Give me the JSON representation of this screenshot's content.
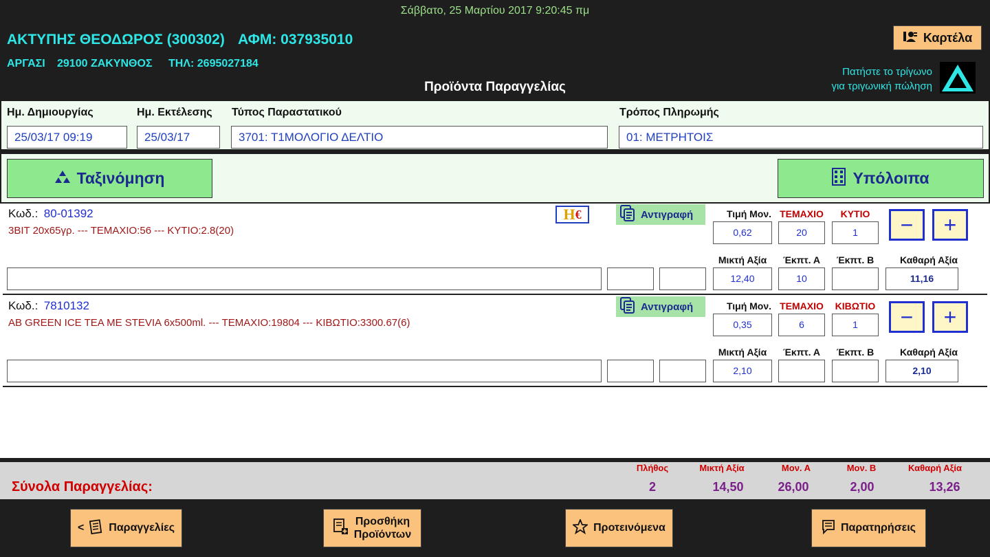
{
  "header": {
    "datetime": "Σάββατο, 25 Μαρτίου 2017   9:20:45 πμ",
    "customer_name": "ΑΚΤΥΠΗΣ ΘΕΟΔΩΡΟΣ (300302)",
    "customer_afm": "ΑΦΜ: 037935010",
    "customer_city": "ΑΡΓΑΣΙ",
    "customer_zip": "29100 ΖΑΚΥΝΘΟΣ",
    "customer_tel": "ΤΗΛ: 2695027184",
    "kartela_label": "Καρτέλα",
    "triangle_hint_1": "Πατήστε το τρίγωνο",
    "triangle_hint_2": "για τριγωνική πώληση",
    "page_title": "Προϊόντα Παραγγελίας"
  },
  "docinfo": {
    "created_label": "Ημ. Δημιουργίας",
    "created_value": "25/03/17 09:19",
    "exec_label": "Ημ. Εκτέλεσης",
    "exec_value": "25/03/17",
    "doctype_label": "Τύπος Παραστατικού",
    "doctype_value": "3701: Τ1ΜΟΛΟΓΙΟ ΔΕΛΤΙΟ",
    "payment_label": "Τρόπος Πληρωμής",
    "payment_value": "01: ΜΕΤΡΗΤΟΙΣ"
  },
  "toolbar": {
    "sort_label": "Ταξινόμηση",
    "balances_label": "Υπόλοιπα"
  },
  "row_labels": {
    "code": "Κωδ.:",
    "copy": "Αντιγραφή",
    "unit_price": "Τιμή Μον.",
    "gross": "Μικτή Αξία",
    "disc_a": "Έκπτ. Α",
    "disc_b": "Έκπτ. Β",
    "net": "Καθαρή Αξία",
    "minus": "−",
    "plus": "+"
  },
  "products": [
    {
      "code": "80-01392",
      "description": "3BIT 20x65γρ. --- ΤΕΜΑΧΙΟ:56 --- ΚΥΤΙΟ:2.8(20)",
      "unit1": "ΤΕΜΑΧΙΟ",
      "unit2": "ΚΥΤΙΟ",
      "unit_price": "0,62",
      "qty1": "20",
      "qty2": "1",
      "gross": "12,40",
      "disc_a": "10",
      "disc_b": "",
      "net": "11,16",
      "comment": "",
      "extra1": "",
      "extra2": "",
      "badge": "H€"
    },
    {
      "code": "7810132",
      "description": "AB GREEN ICE TEA ME STEVIA 6x500ml. --- ΤΕΜΑΧΙΟ:19804 --- ΚΙΒΩΤΙΟ:3300.67(6)",
      "unit1": "ΤΕΜΑΧΙΟ",
      "unit2": "ΚΙΒΩΤΙΟ",
      "unit_price": "0,35",
      "qty1": "6",
      "qty2": "1",
      "gross": "2,10",
      "disc_a": "",
      "disc_b": "",
      "net": "2,10",
      "comment": "",
      "extra1": "",
      "extra2": ""
    }
  ],
  "totals": {
    "label": "Σύνολα Παραγγελίας:",
    "count_label": "Πλήθος",
    "count": "2",
    "gross_label": "Μικτή Αξία",
    "gross": "14,50",
    "units_a_label": "Μον. Α",
    "units_a": "26,00",
    "units_b_label": "Μον. Β",
    "units_b": "2,00",
    "net_label": "Καθαρή Αξία",
    "net": "13,26"
  },
  "footer": {
    "orders_label": "Παραγγελίες",
    "orders_prefix": "<",
    "add_products_label_1": "Προσθήκη",
    "add_products_label_2": "Προϊόντων",
    "suggested_label": "Προτεινόμενα",
    "notes_label": "Παρατηρήσεις"
  },
  "colors": {
    "dark_bg": "#1e1e1e",
    "cyan": "#2ee6e6",
    "green_btn": "#8ee88e",
    "orange_btn": "#fbc27e",
    "blue_text": "#1f2fd0",
    "red_text": "#c00000",
    "purple_total": "#7a1f8a"
  },
  "icons": [
    "person-card-icon",
    "triangle-icon",
    "cluster-sort-icon",
    "building-icon",
    "hellenic-euro-icon",
    "copy-icon",
    "orders-list-icon",
    "add-product-icon",
    "star-icon",
    "note-icon"
  ]
}
